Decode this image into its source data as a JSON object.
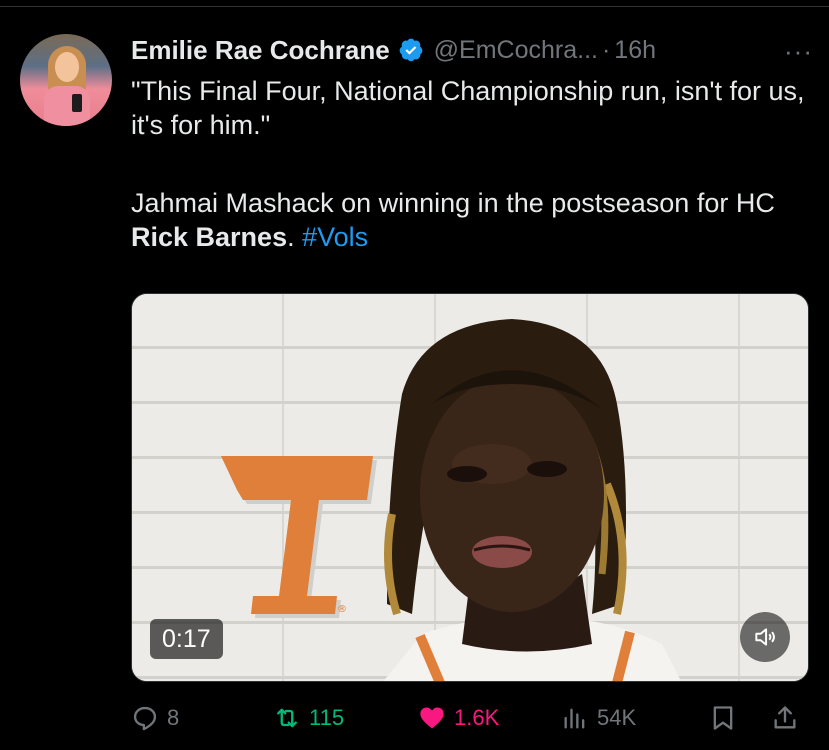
{
  "tweet": {
    "author_name": "Emilie Rae Cochrane",
    "author_handle": "@EmCochra...",
    "separator": "·",
    "timestamp": "16h",
    "more_label": "···",
    "text_line1": "\"This Final Four, National Championship run, isn't for us, it's for him.\"",
    "text_line2_prefix": "Jahmai Mashack on winning in the postseason for HC ",
    "text_bold": "Rick Barnes",
    "text_suffix": ". ",
    "hashtag": "#Vols"
  },
  "media": {
    "duration": "0:17",
    "logo_registered": "®"
  },
  "actions": {
    "replies": "8",
    "retweets": "115",
    "likes": "1.6K",
    "views": "54K"
  },
  "colors": {
    "background": "#000000",
    "text": "#e7e9ea",
    "secondary": "#71767b",
    "accent_blue": "#1d9bf0",
    "retweet_green": "#00ba7c",
    "like_pink": "#f91880",
    "tennessee_orange": "#e07f3a"
  },
  "icons": {
    "verified": "verified-badge-icon",
    "reply": "reply-icon",
    "retweet": "retweet-icon",
    "like": "heart-icon",
    "views": "views-icon",
    "bookmark": "bookmark-icon",
    "share": "share-icon",
    "sound": "speaker-icon"
  }
}
